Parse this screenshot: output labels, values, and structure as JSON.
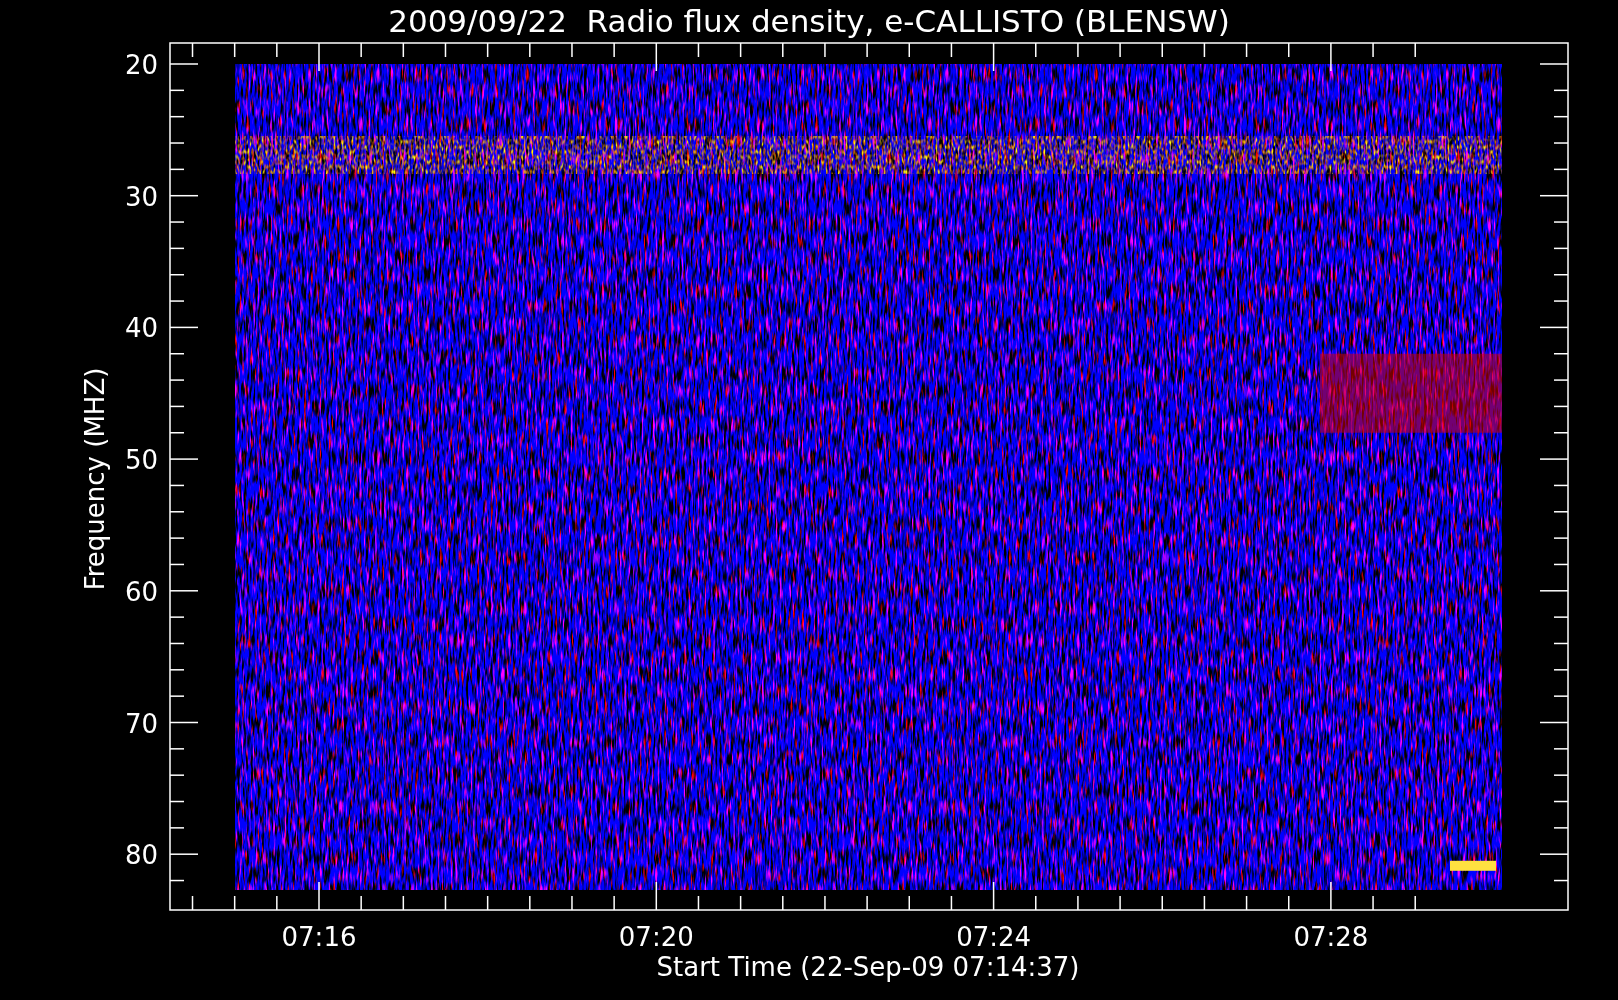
{
  "title": "2009/09/22  Radio flux density, e-CALLISTO (BLENSW)",
  "y_axis": {
    "label": "Frequency (MHZ)",
    "ticks": [
      "20",
      "30",
      "40",
      "50",
      "60",
      "70",
      "80"
    ]
  },
  "x_axis": {
    "label": "Start Time (22-Sep-09 07:14:37)",
    "ticks": [
      "07:16",
      "07:20",
      "07:24",
      "07:28"
    ]
  }
}
